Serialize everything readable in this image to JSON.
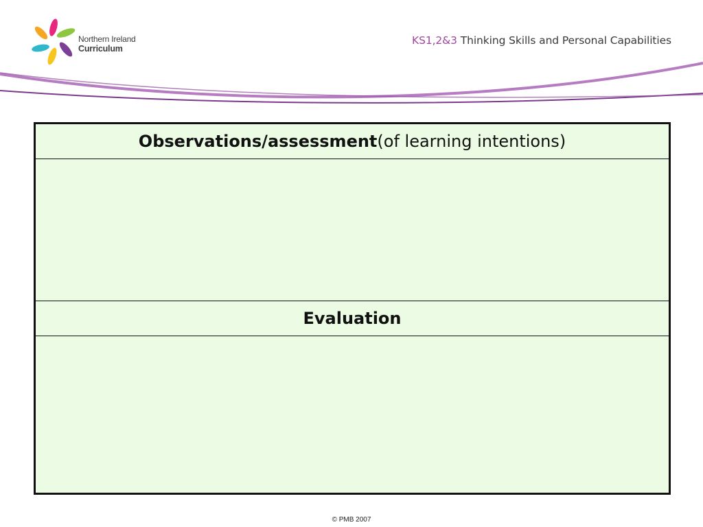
{
  "logo": {
    "line1": "Northern Ireland",
    "line2": "Curriculum",
    "colors": [
      "#e8267d",
      "#f5a623",
      "#8dc63f",
      "#2eb8c9",
      "#f7c51e",
      "#7b3f98"
    ]
  },
  "header": {
    "title_accent": "KS1,2&3",
    "title_rest": " Thinking Skills and Personal Capabilities",
    "accent_color": "#a0479b"
  },
  "table": {
    "background": "#ecfce4",
    "observations_heading_bold": "Observations/assessment",
    "observations_heading_rest": " (of learning intentions)",
    "observations_body": "",
    "evaluation_heading": "Evaluation",
    "evaluation_body": ""
  },
  "footer": {
    "copyright": "© PMB 2007"
  }
}
